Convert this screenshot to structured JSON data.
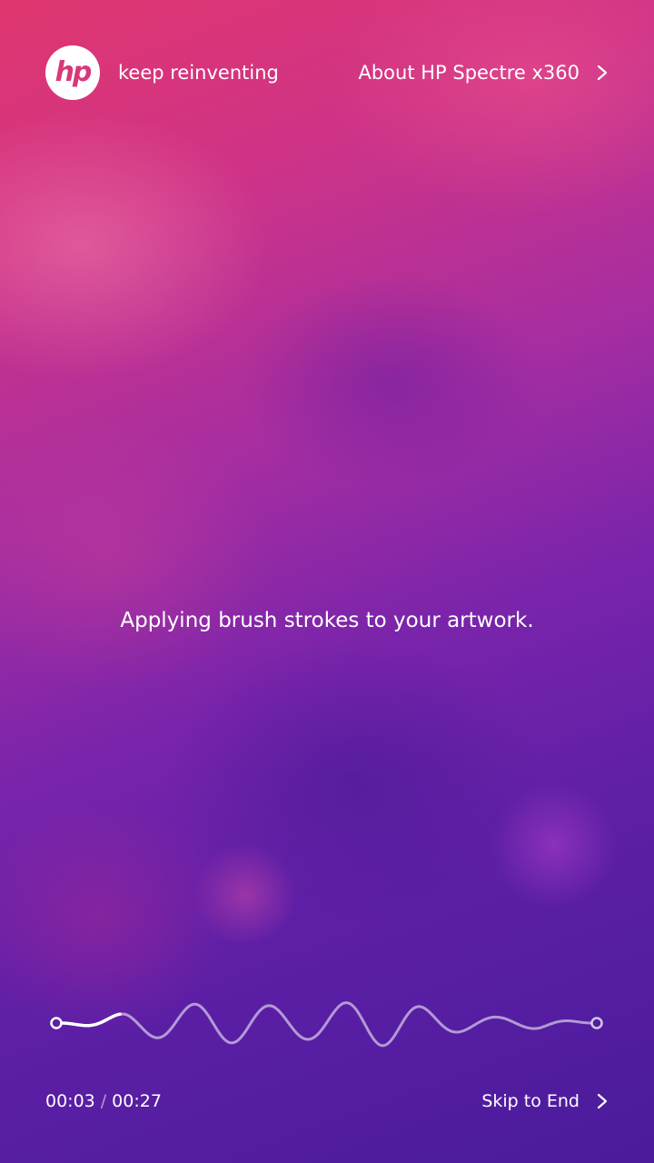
{
  "brand": {
    "logo_text": "hp",
    "tagline": "keep reinventing",
    "primary_color": "#d8387a"
  },
  "header": {
    "about_label": "About HP Spectre x360"
  },
  "status": {
    "message": "Applying brush strokes to your artwork."
  },
  "playback": {
    "current_time": "00:03",
    "separator": "/",
    "total_time": "00:27",
    "progress_fraction": 0.11
  },
  "footer": {
    "skip_label": "Skip to End"
  },
  "icons": {
    "about_chevron": "chevron-right-icon",
    "skip_chevron": "chevron-right-icon"
  }
}
